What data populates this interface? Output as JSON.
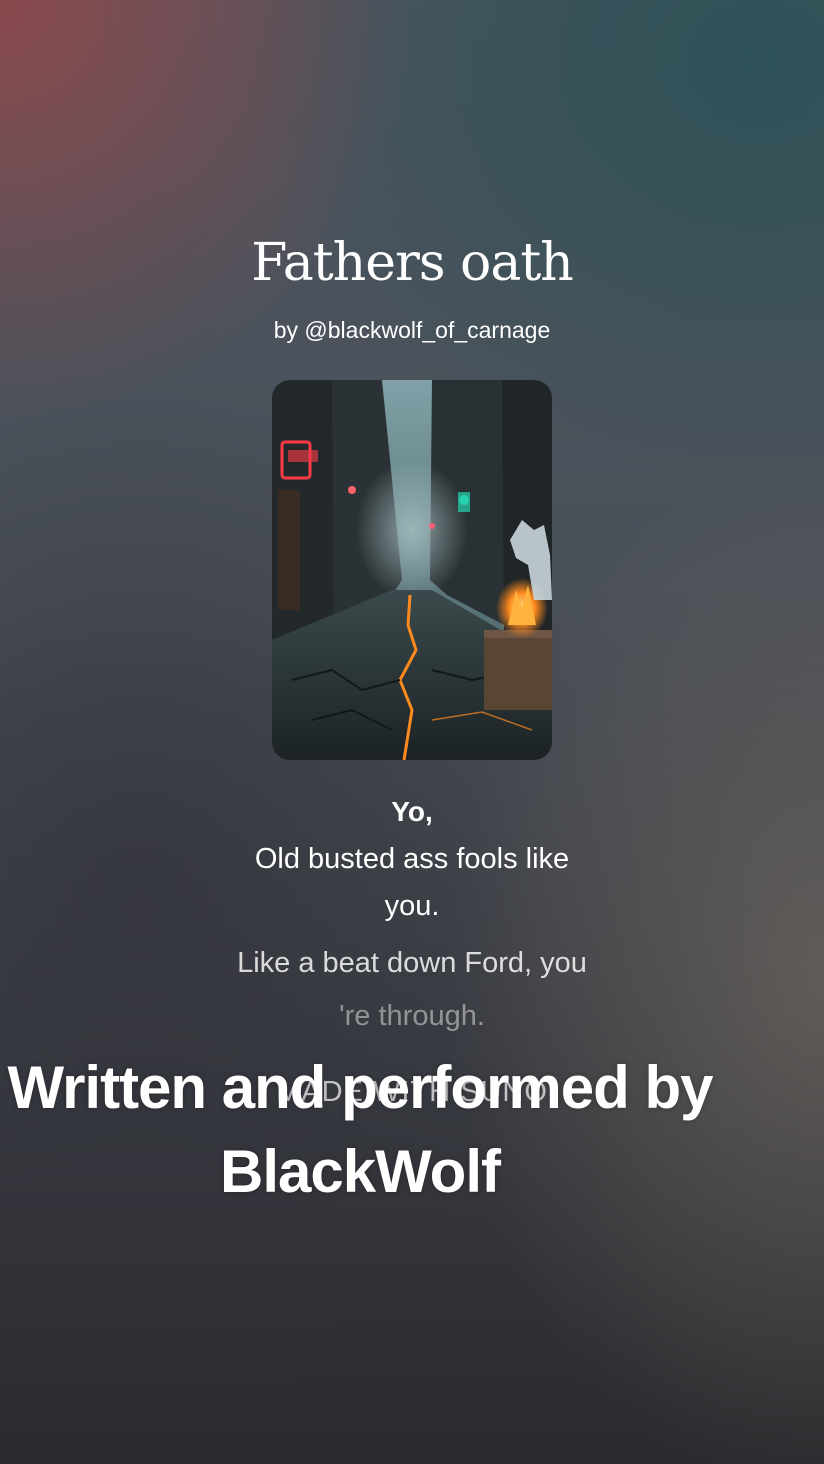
{
  "song": {
    "title": "Fathers oath",
    "author": "by @blackwolf_of_carnage"
  },
  "cover": {
    "icon": "neon-alley-wolf-artwork",
    "accent_colors": [
      "#ff3b4a",
      "#27d3b0",
      "#ff8a1e"
    ]
  },
  "lyrics": {
    "heading": "Yo,",
    "lines": [
      "Old busted ass fools like you.",
      "Like a beat down Ford, you",
      "'re through."
    ]
  },
  "watermark": "MADE WITH SUNO",
  "caption": {
    "line1": "Written and performed by",
    "line2": "BlackWolf"
  }
}
